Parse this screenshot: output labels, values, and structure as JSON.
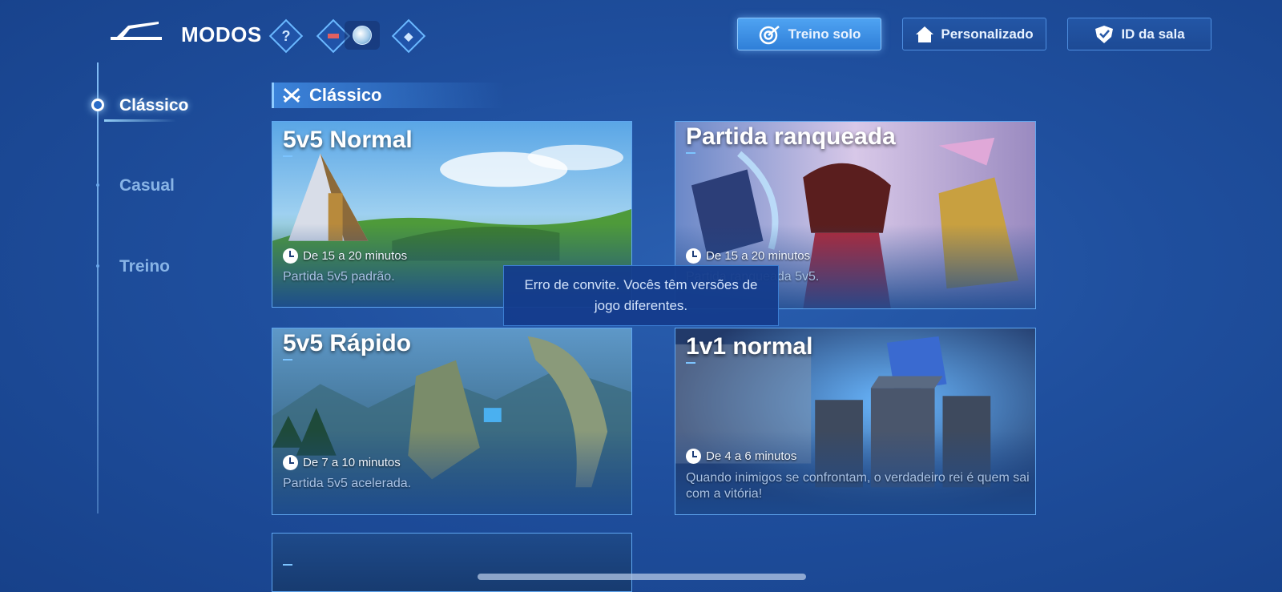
{
  "header": {
    "title": "MODOS",
    "help_label": "?",
    "buttons": [
      {
        "label": "Treino solo",
        "icon": "target-icon",
        "active": true
      },
      {
        "label": "Personalizado",
        "icon": "home-icon",
        "active": false
      },
      {
        "label": "ID da sala",
        "icon": "shield-icon",
        "active": false
      }
    ]
  },
  "sidebar": {
    "items": [
      {
        "label": "Clássico",
        "active": true
      },
      {
        "label": "Casual",
        "active": false
      },
      {
        "label": "Treino",
        "active": false
      }
    ]
  },
  "section": {
    "title": "Clássico",
    "icon": "crossed-swords-icon"
  },
  "cards": [
    {
      "title": "5v5 Normal",
      "duration": "De 15 a 20 minutos",
      "description": "Partida 5v5 padrão."
    },
    {
      "title": "Partida ranqueada",
      "duration": "De 15 a 20 minutos",
      "description": "Partida ranqueada 5v5."
    },
    {
      "title": "5v5 Rápido",
      "duration": "De 7 a 10 minutos",
      "description": "Partida 5v5 acelerada."
    },
    {
      "title": "1v1 normal",
      "duration": "De 4 a 6 minutos",
      "description": "Quando inimigos se confrontam, o verdadeiro rei é quem sai com a vitória!"
    }
  ],
  "toast": {
    "message": "Erro de convite. Vocês têm versões de jogo diferentes."
  },
  "colors": {
    "background": "#1f4f9e",
    "accent": "#5fa6f0",
    "active_button": "#3f93e8"
  }
}
